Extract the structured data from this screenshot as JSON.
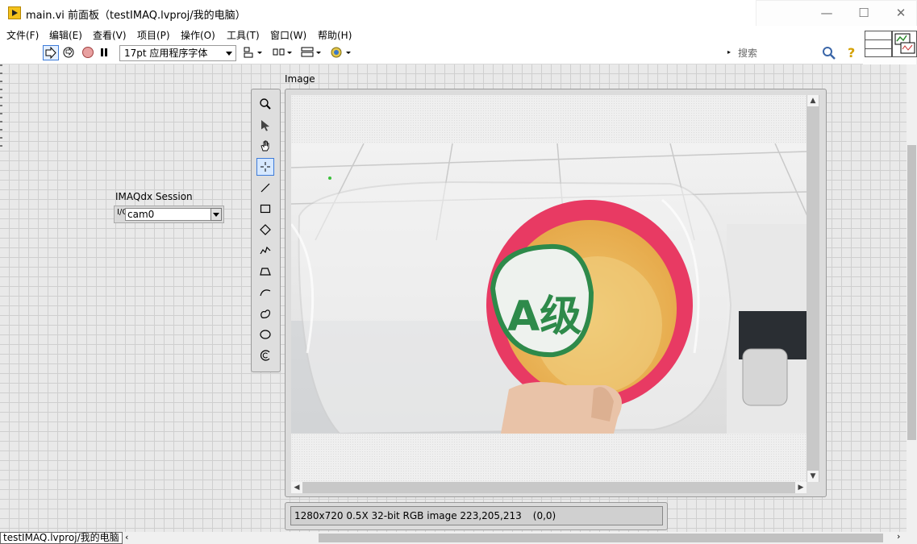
{
  "window": {
    "title": "main.vi 前面板（testIMAQ.lvproj/我的电脑）",
    "minimize": "—",
    "maximize": "☐",
    "close": "✕"
  },
  "menu": [
    "文件(F)",
    "编辑(E)",
    "查看(V)",
    "项目(P)",
    "操作(O)",
    "工具(T)",
    "窗口(W)",
    "帮助(H)"
  ],
  "toolbar": {
    "font": "17pt 应用程序字体",
    "search_placeholder": "搜索"
  },
  "session": {
    "label": "IMAQdx Session",
    "value": "cam0"
  },
  "image_display": {
    "label": "Image",
    "status": "1280x720 0.5X 32-bit RGB image 223,205,213",
    "coord": "(0,0)",
    "photo_sticker": "A级"
  },
  "tools": [
    "zoom-icon",
    "pointer-icon",
    "pan-icon",
    "crosshair-icon",
    "line-icon",
    "rectangle-icon",
    "rotated-rect-icon",
    "freehand-line-icon",
    "polygon-icon",
    "freehand-icon",
    "closed-freehand-icon",
    "oval-icon",
    "annulus-icon"
  ],
  "project": "testIMAQ.lvproj/我的电脑"
}
